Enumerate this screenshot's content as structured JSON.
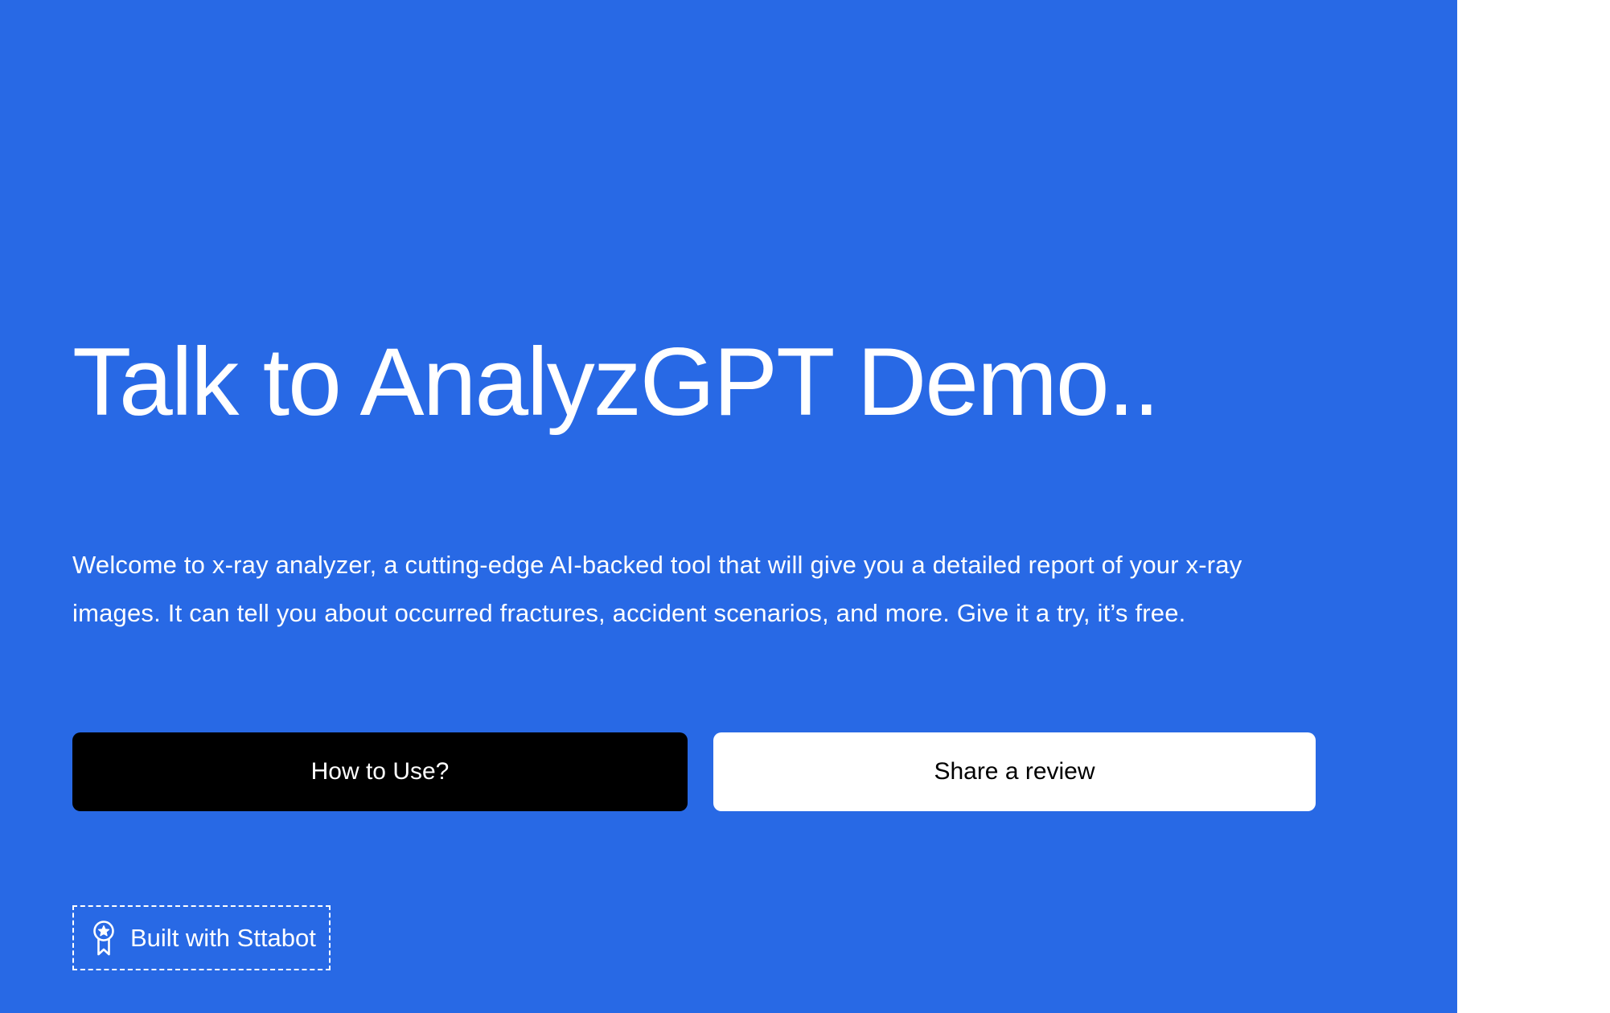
{
  "hero": {
    "title": "Talk to AnalyzGPT Demo..",
    "description": "Welcome to x-ray analyzer, a cutting-edge AI-backed tool that will give you a detailed report of your x-ray images. It can tell you about occurred fractures, accident scenarios, and more. Give it a try, it’s free."
  },
  "buttons": {
    "how_to_use_label": "How to Use?",
    "share_review_label": "Share a review"
  },
  "badge": {
    "label": "Built with Sttabot",
    "icon": "award-ribbon-icon"
  },
  "colors": {
    "background": "#2869e5",
    "primary_button": "#000000",
    "secondary_button": "#ffffff",
    "text": "#ffffff"
  }
}
